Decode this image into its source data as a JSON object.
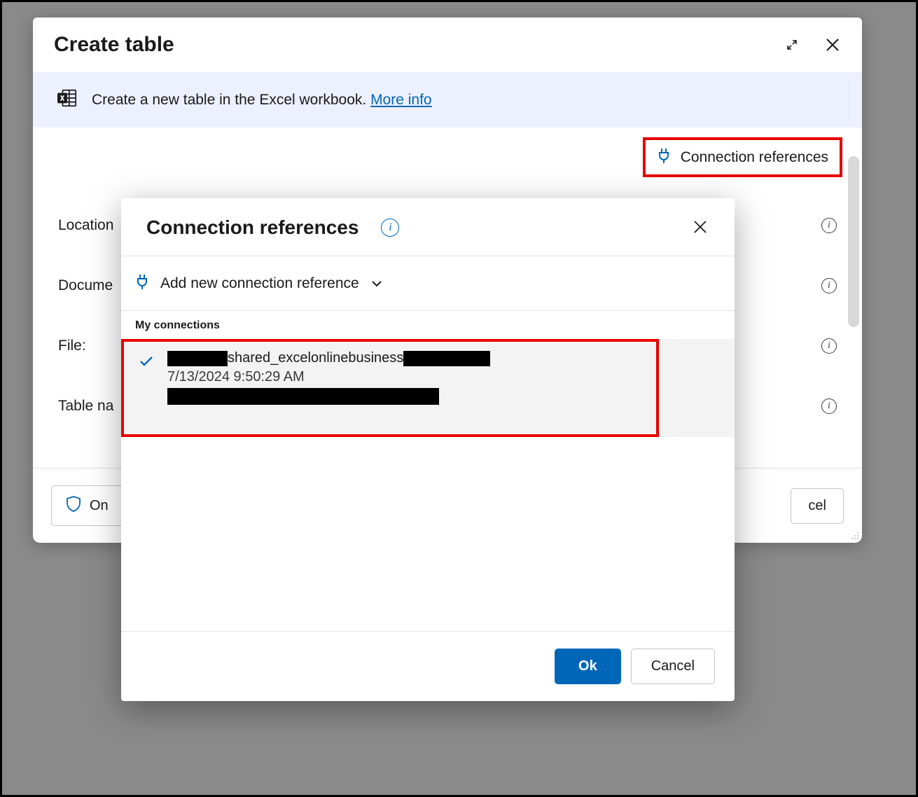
{
  "main": {
    "title": "Create table",
    "banner_text": "Create a new table in the Excel workbook.",
    "more_info": "More info",
    "connection_references_label": "Connection references",
    "form": {
      "location": "Location",
      "document": "Docume",
      "file": "File:",
      "table_name": "Table na"
    },
    "footer": {
      "left_label": "On",
      "right_label": "cel"
    }
  },
  "overlay": {
    "title": "Connection references",
    "add_new_label": "Add new connection reference",
    "section_label": "My connections",
    "connection": {
      "name_visible": "shared_excelonlinebusiness",
      "timestamp": "7/13/2024 9:50:29 AM"
    },
    "ok": "Ok",
    "cancel": "Cancel"
  }
}
